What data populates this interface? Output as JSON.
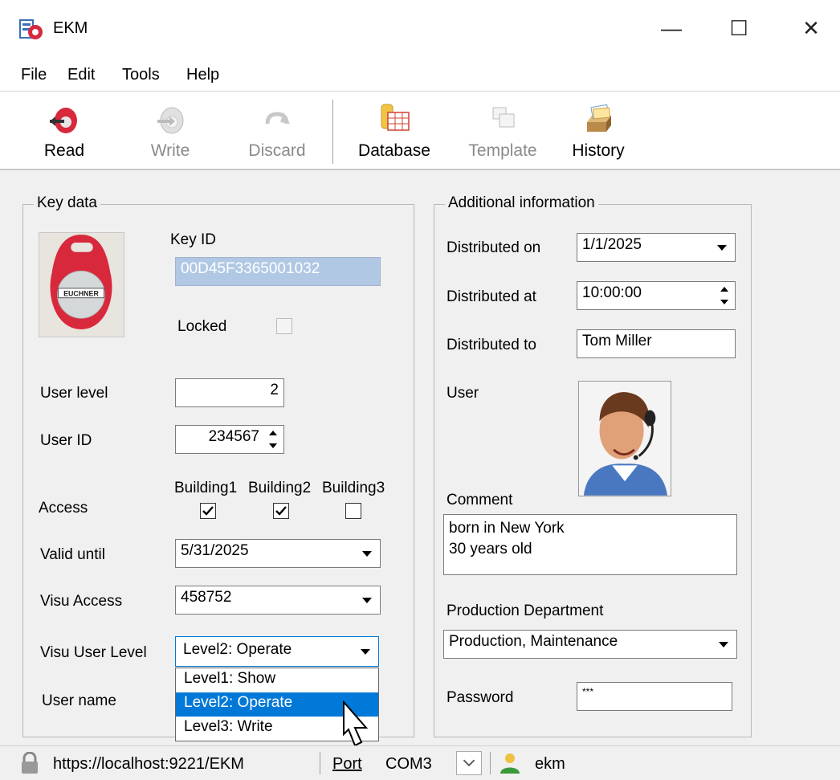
{
  "window": {
    "title": "EKM",
    "minimize": "—",
    "maximize": "☐",
    "close": "✕"
  },
  "menu": [
    "File",
    "Edit",
    "Tools",
    "Help"
  ],
  "toolbar": {
    "read": "Read",
    "write": "Write",
    "discard": "Discard",
    "database": "Database",
    "template": "Template",
    "history": "History"
  },
  "key_data": {
    "title": "Key data",
    "key_id_label": "Key ID",
    "key_id_value": "00D45F3365001032",
    "key_brand": "EUCHNER",
    "locked_label": "Locked",
    "locked": false,
    "user_level_label": "User level",
    "user_level_value": "2",
    "user_id_label": "User ID",
    "user_id_value": "234567",
    "access_label": "Access",
    "buildings": [
      {
        "name": "Building1",
        "checked": true
      },
      {
        "name": "Building2",
        "checked": true
      },
      {
        "name": "Building3",
        "checked": false
      }
    ],
    "valid_until_label": "Valid until",
    "valid_until_value": "5/31/2025",
    "visu_access_label": "Visu Access",
    "visu_access_value": "458752",
    "visu_user_level_label": "Visu User Level",
    "visu_user_level_value": "Level2: Operate",
    "visu_user_level_options": [
      "Level1: Show",
      "Level2: Operate",
      "Level3: Write"
    ],
    "visu_user_level_selected_index": 1,
    "user_name_label": "User name"
  },
  "additional": {
    "title": "Additional information",
    "distributed_on_label": "Distributed on",
    "distributed_on_value": "1/1/2025",
    "distributed_at_label": "Distributed at",
    "distributed_at_value": "10:00:00",
    "distributed_to_label": "Distributed to",
    "distributed_to_value": "Tom Miller",
    "user_label": "User",
    "comment_label": "Comment",
    "comment_line1": "born in New York",
    "comment_line2": "30 years old",
    "production_department_label": "Production Department",
    "production_department_value": "Production, Maintenance",
    "password_label": "Password",
    "password_value": "***"
  },
  "status": {
    "url": "https://localhost:9221/EKM",
    "port_label": "Port",
    "port_value": "COM3",
    "user": "ekm"
  },
  "colors": {
    "accent": "#0078d7",
    "key_red": "#d8283c",
    "readonly_field": "#b0c8e4"
  }
}
